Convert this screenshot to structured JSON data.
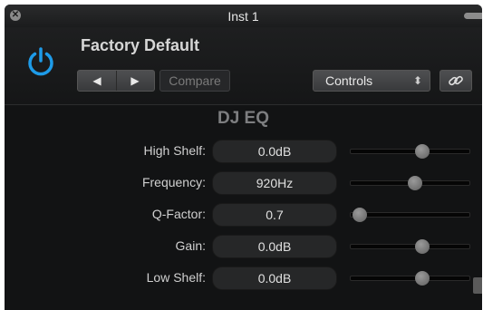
{
  "window": {
    "title": "Inst 1"
  },
  "header": {
    "preset_name": "Factory Default",
    "prev_label": "◀",
    "next_label": "▶",
    "compare_label": "Compare",
    "view_mode": "Controls",
    "accent_color": "#1e9be8"
  },
  "plugin": {
    "title": "DJ EQ",
    "params": [
      {
        "label": "High Shelf:",
        "value": "0.0dB",
        "slider_position": 0.62
      },
      {
        "label": "Frequency:",
        "value": "920Hz",
        "slider_position": 0.55
      },
      {
        "label": "Q-Factor:",
        "value": "0.7",
        "slider_position": 0.0
      },
      {
        "label": "Gain:",
        "value": "0.0dB",
        "slider_position": 0.62
      },
      {
        "label": "Low Shelf:",
        "value": "0.0dB",
        "slider_position": 0.62
      }
    ]
  }
}
